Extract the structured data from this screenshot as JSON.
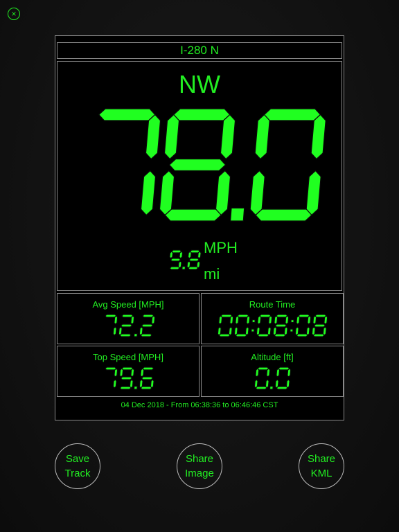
{
  "close_button": {
    "icon": "close-icon",
    "glyph": "×"
  },
  "road_name": "I-280 N",
  "heading": "NW",
  "speed": {
    "value": "78.0",
    "unit": "MPH"
  },
  "distance": {
    "value": "9.8",
    "unit": "mi"
  },
  "stats": [
    {
      "label": "Avg Speed [MPH]",
      "value": "72.2"
    },
    {
      "label": "Route Time",
      "value": "00:08:08"
    },
    {
      "label": "Top Speed [MPH]",
      "value": "79.6"
    },
    {
      "label": "Altitude [ft]",
      "value": "0.0"
    }
  ],
  "trip_summary": "04 Dec 2018 - From 06:38:36 to 06:46:46 CST",
  "buttons": {
    "save_track": "Save\nTrack",
    "share_image": "Share\nImage",
    "share_kml": "Share\nKML"
  },
  "colors": {
    "accent": "#22ee22",
    "background": "#101010",
    "border": "#8a8a8a"
  }
}
